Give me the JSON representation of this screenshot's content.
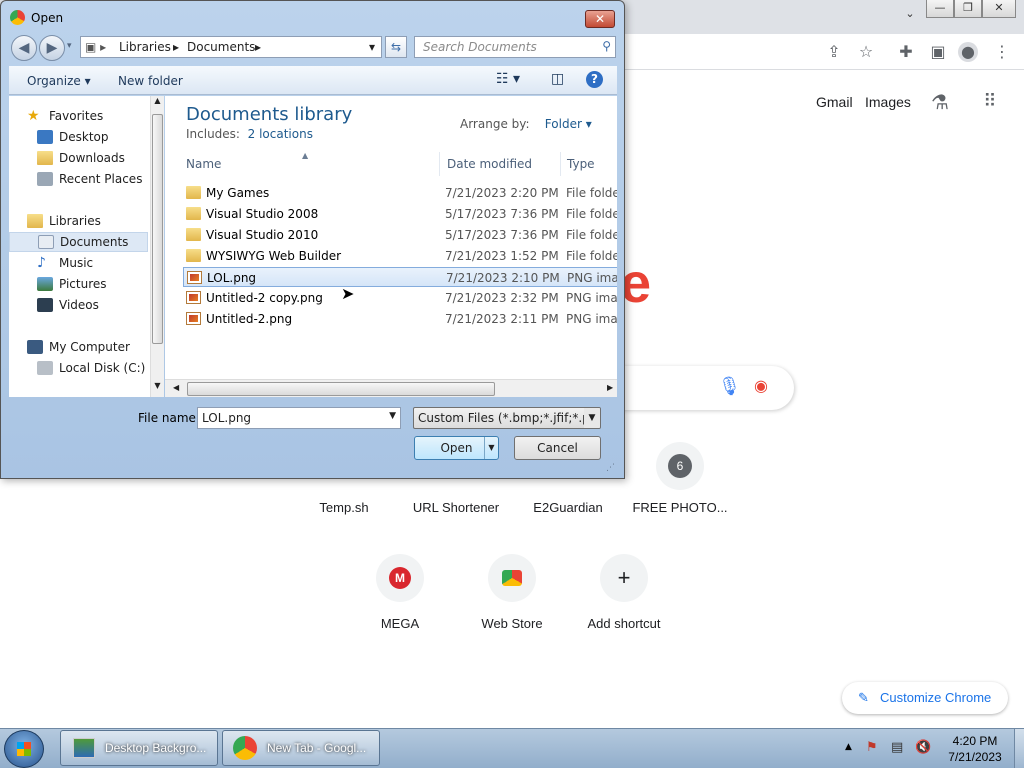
{
  "browser": {
    "top_links": [
      "Gmail",
      "Images"
    ],
    "shortcuts_row1": [
      {
        "label": "Temp.sh"
      },
      {
        "label": "URL Shortener"
      },
      {
        "label": "E2Guardian"
      },
      {
        "label": "FREE PHOTO...",
        "badge": "6"
      }
    ],
    "shortcuts_row2": [
      {
        "label": "MEGA"
      },
      {
        "label": "Web Store"
      },
      {
        "label": "Add shortcut"
      }
    ],
    "customize_label": "Customize Chrome",
    "colors": {
      "accent": "#1a73e8",
      "google_red": "#ea4335"
    }
  },
  "dialog": {
    "title": "Open",
    "close_glyph": "✕",
    "address_path": [
      "Libraries",
      "Documents"
    ],
    "search_placeholder": "Search Documents",
    "toolbar": {
      "organize": "Organize ▾",
      "new_folder": "New folder"
    },
    "nav": {
      "favorites_header": "Favorites",
      "favorites": [
        "Desktop",
        "Downloads",
        "Recent Places"
      ],
      "libraries_header": "Libraries",
      "libraries": [
        "Documents",
        "Music",
        "Pictures",
        "Videos"
      ],
      "computer_header": "My Computer",
      "computer": [
        "Local Disk (C:)"
      ],
      "selected": "Documents"
    },
    "library": {
      "title": "Documents library",
      "includes_label": "Includes:",
      "includes_link": "2 locations",
      "arrange_label": "Arrange by:",
      "arrange_value": "Folder ▾"
    },
    "columns": [
      "Name",
      "Date modified",
      "Type"
    ],
    "files": [
      {
        "name": "My Games",
        "date": "7/21/2023 2:20 PM",
        "type": "File folder",
        "kind": "folder"
      },
      {
        "name": "Visual Studio 2008",
        "date": "5/17/2023 7:36 PM",
        "type": "File folder",
        "kind": "folder"
      },
      {
        "name": "Visual Studio 2010",
        "date": "5/17/2023 7:36 PM",
        "type": "File folder",
        "kind": "folder"
      },
      {
        "name": "WYSIWYG Web Builder",
        "date": "7/21/2023 1:52 PM",
        "type": "File folder",
        "kind": "folder"
      },
      {
        "name": "LOL.png",
        "date": "7/21/2023 2:10 PM",
        "type": "PNG image",
        "kind": "png"
      },
      {
        "name": "Untitled-2 copy.png",
        "date": "7/21/2023 2:32 PM",
        "type": "PNG image",
        "kind": "png"
      },
      {
        "name": "Untitled-2.png",
        "date": "7/21/2023 2:11 PM",
        "type": "PNG image",
        "kind": "png"
      }
    ],
    "selected_file": "LOL.png",
    "file_name_label": "File name:",
    "file_name_value": "LOL.png",
    "file_type_value": "Custom Files (*.bmp;*.jfif;*.pjpeg",
    "open_label": "Open",
    "cancel_label": "Cancel"
  },
  "taskbar": {
    "items": [
      "Desktop Backgro...",
      "New Tab - Googl..."
    ],
    "time": "4:20 PM",
    "date": "7/21/2023"
  }
}
